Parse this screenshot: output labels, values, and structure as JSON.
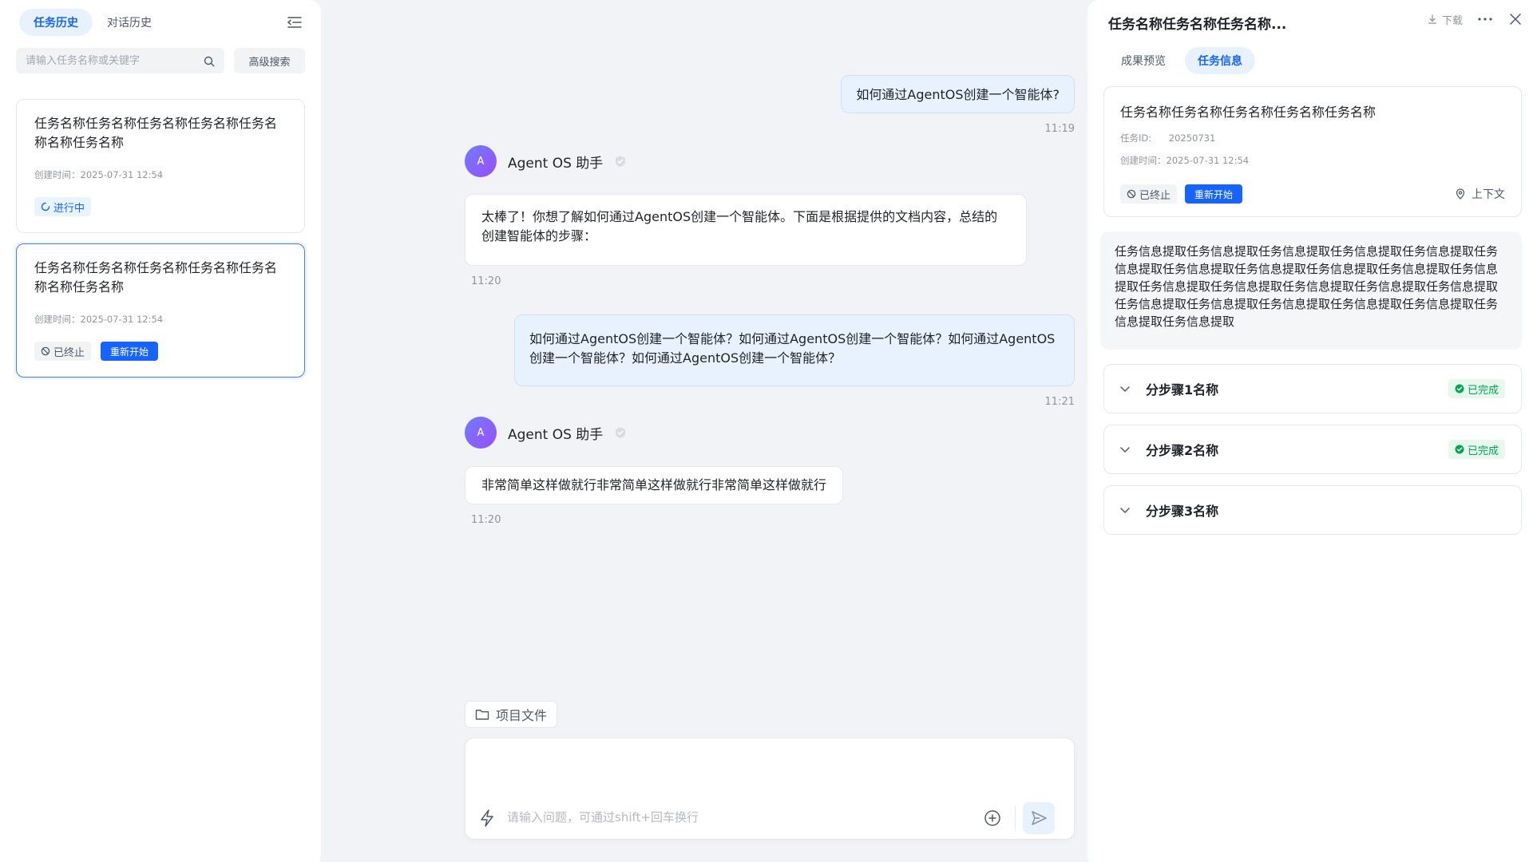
{
  "sidebar": {
    "tabs": [
      {
        "label": "任务历史",
        "active": true
      },
      {
        "label": "对话历史",
        "active": false
      }
    ],
    "search_placeholder": "请输入任务名称或关键字",
    "advanced_search_label": "高级搜索",
    "tasks": [
      {
        "title": "任务名称任务名称任务名称任务名称任务名称名称任务名称",
        "created": "创建时间：2025-07-31 12:54",
        "status_label": "进行中",
        "status": "running"
      },
      {
        "title": "任务名称任务名称任务名称任务名称任务名称名称任务名称",
        "created": "创建时间：2025-07-31 12:54",
        "status_label": "已终止",
        "status": "stopped",
        "restart_label": "重新开始"
      }
    ]
  },
  "chat": {
    "messages": [
      {
        "role": "user",
        "text": "如何通过AgentOS创建一个智能体?",
        "time": "11:19"
      },
      {
        "role": "assistant",
        "agent": "Agent OS 助手",
        "avatar_letter": "A",
        "text": "太棒了！你想了解如何通过AgentOS创建一个智能体。下面是根据提供的文档内容，总结的创建智能体的步骤：",
        "time": "11:20"
      },
      {
        "role": "user",
        "text": "如何通过AgentOS创建一个智能体？如何通过AgentOS创建一个智能体？如何通过AgentOS创建一个智能体？如何通过AgentOS创建一个智能体？",
        "time": "11:21"
      },
      {
        "role": "assistant",
        "agent": "Agent OS 助手",
        "avatar_letter": "A",
        "text": "非常简单这样做就行非常简单这样做就行非常简单这样做就行",
        "time": "11:20"
      }
    ],
    "project_files_label": "项目文件",
    "input_placeholder": "请输入问题，可通过shift+回车换行"
  },
  "detail": {
    "title": "任务名称任务名称任务名称...",
    "download_label": "下载",
    "tabs": [
      {
        "label": "成果预览",
        "active": false
      },
      {
        "label": "任务信息",
        "active": true
      }
    ],
    "task": {
      "title": "任务名称任务名称任务名称任务名称任务名称",
      "id_key": "任务ID:",
      "id_value": "20250731",
      "created": "创建时间：2025-07-31 12:54",
      "status_label": "已终止",
      "restart_label": "重新开始",
      "context_label": "上下文"
    },
    "extract_text": "任务信息提取任务信息提取任务信息提取任务信息提取任务信息提取任务信息提取任务信息提取任务信息提取任务信息提取任务信息提取任务信息提取任务信息提取任务信息提取任务信息提取任务信息提取任务信息提取任务信息提取任务信息提取任务信息提取任务信息提取任务信息提取任务信息提取任务信息提取",
    "steps": [
      {
        "name": "分步骤1名称",
        "status_label": "已完成"
      },
      {
        "name": "分步骤2名称",
        "status_label": "已完成"
      },
      {
        "name": "分步骤3名称",
        "status_label": ""
      }
    ]
  },
  "colors": {
    "accent": "#1664ff",
    "accent_bg": "#e8f2ff",
    "success": "#00a650",
    "page_bg": "#f1f3f6"
  }
}
